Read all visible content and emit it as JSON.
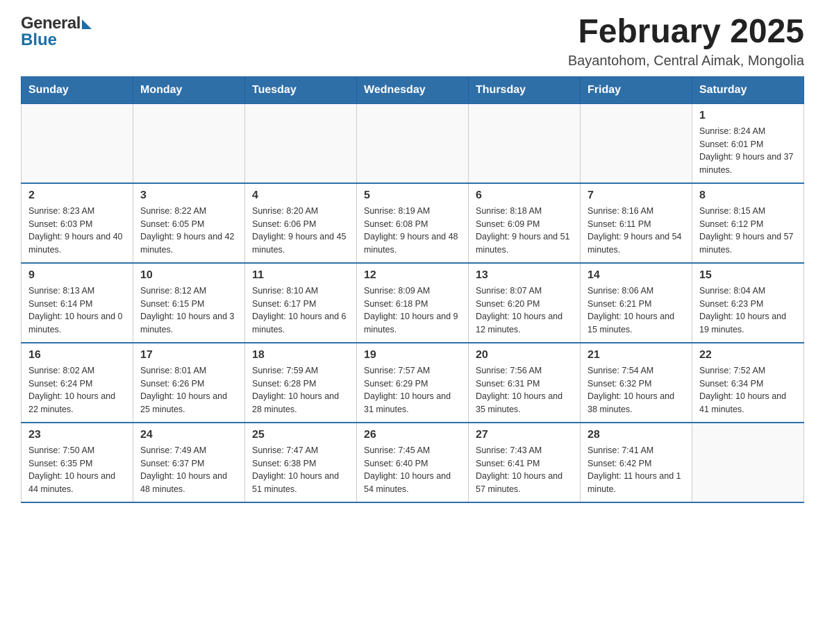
{
  "header": {
    "title": "February 2025",
    "subtitle": "Bayantohom, Central Aimak, Mongolia",
    "logo_general": "General",
    "logo_blue": "Blue"
  },
  "weekdays": [
    "Sunday",
    "Monday",
    "Tuesday",
    "Wednesday",
    "Thursday",
    "Friday",
    "Saturday"
  ],
  "weeks": [
    {
      "days": [
        {
          "num": "",
          "info": ""
        },
        {
          "num": "",
          "info": ""
        },
        {
          "num": "",
          "info": ""
        },
        {
          "num": "",
          "info": ""
        },
        {
          "num": "",
          "info": ""
        },
        {
          "num": "",
          "info": ""
        },
        {
          "num": "1",
          "info": "Sunrise: 8:24 AM\nSunset: 6:01 PM\nDaylight: 9 hours and 37 minutes."
        }
      ]
    },
    {
      "days": [
        {
          "num": "2",
          "info": "Sunrise: 8:23 AM\nSunset: 6:03 PM\nDaylight: 9 hours and 40 minutes."
        },
        {
          "num": "3",
          "info": "Sunrise: 8:22 AM\nSunset: 6:05 PM\nDaylight: 9 hours and 42 minutes."
        },
        {
          "num": "4",
          "info": "Sunrise: 8:20 AM\nSunset: 6:06 PM\nDaylight: 9 hours and 45 minutes."
        },
        {
          "num": "5",
          "info": "Sunrise: 8:19 AM\nSunset: 6:08 PM\nDaylight: 9 hours and 48 minutes."
        },
        {
          "num": "6",
          "info": "Sunrise: 8:18 AM\nSunset: 6:09 PM\nDaylight: 9 hours and 51 minutes."
        },
        {
          "num": "7",
          "info": "Sunrise: 8:16 AM\nSunset: 6:11 PM\nDaylight: 9 hours and 54 minutes."
        },
        {
          "num": "8",
          "info": "Sunrise: 8:15 AM\nSunset: 6:12 PM\nDaylight: 9 hours and 57 minutes."
        }
      ]
    },
    {
      "days": [
        {
          "num": "9",
          "info": "Sunrise: 8:13 AM\nSunset: 6:14 PM\nDaylight: 10 hours and 0 minutes."
        },
        {
          "num": "10",
          "info": "Sunrise: 8:12 AM\nSunset: 6:15 PM\nDaylight: 10 hours and 3 minutes."
        },
        {
          "num": "11",
          "info": "Sunrise: 8:10 AM\nSunset: 6:17 PM\nDaylight: 10 hours and 6 minutes."
        },
        {
          "num": "12",
          "info": "Sunrise: 8:09 AM\nSunset: 6:18 PM\nDaylight: 10 hours and 9 minutes."
        },
        {
          "num": "13",
          "info": "Sunrise: 8:07 AM\nSunset: 6:20 PM\nDaylight: 10 hours and 12 minutes."
        },
        {
          "num": "14",
          "info": "Sunrise: 8:06 AM\nSunset: 6:21 PM\nDaylight: 10 hours and 15 minutes."
        },
        {
          "num": "15",
          "info": "Sunrise: 8:04 AM\nSunset: 6:23 PM\nDaylight: 10 hours and 19 minutes."
        }
      ]
    },
    {
      "days": [
        {
          "num": "16",
          "info": "Sunrise: 8:02 AM\nSunset: 6:24 PM\nDaylight: 10 hours and 22 minutes."
        },
        {
          "num": "17",
          "info": "Sunrise: 8:01 AM\nSunset: 6:26 PM\nDaylight: 10 hours and 25 minutes."
        },
        {
          "num": "18",
          "info": "Sunrise: 7:59 AM\nSunset: 6:28 PM\nDaylight: 10 hours and 28 minutes."
        },
        {
          "num": "19",
          "info": "Sunrise: 7:57 AM\nSunset: 6:29 PM\nDaylight: 10 hours and 31 minutes."
        },
        {
          "num": "20",
          "info": "Sunrise: 7:56 AM\nSunset: 6:31 PM\nDaylight: 10 hours and 35 minutes."
        },
        {
          "num": "21",
          "info": "Sunrise: 7:54 AM\nSunset: 6:32 PM\nDaylight: 10 hours and 38 minutes."
        },
        {
          "num": "22",
          "info": "Sunrise: 7:52 AM\nSunset: 6:34 PM\nDaylight: 10 hours and 41 minutes."
        }
      ]
    },
    {
      "days": [
        {
          "num": "23",
          "info": "Sunrise: 7:50 AM\nSunset: 6:35 PM\nDaylight: 10 hours and 44 minutes."
        },
        {
          "num": "24",
          "info": "Sunrise: 7:49 AM\nSunset: 6:37 PM\nDaylight: 10 hours and 48 minutes."
        },
        {
          "num": "25",
          "info": "Sunrise: 7:47 AM\nSunset: 6:38 PM\nDaylight: 10 hours and 51 minutes."
        },
        {
          "num": "26",
          "info": "Sunrise: 7:45 AM\nSunset: 6:40 PM\nDaylight: 10 hours and 54 minutes."
        },
        {
          "num": "27",
          "info": "Sunrise: 7:43 AM\nSunset: 6:41 PM\nDaylight: 10 hours and 57 minutes."
        },
        {
          "num": "28",
          "info": "Sunrise: 7:41 AM\nSunset: 6:42 PM\nDaylight: 11 hours and 1 minute."
        },
        {
          "num": "",
          "info": ""
        }
      ]
    }
  ]
}
